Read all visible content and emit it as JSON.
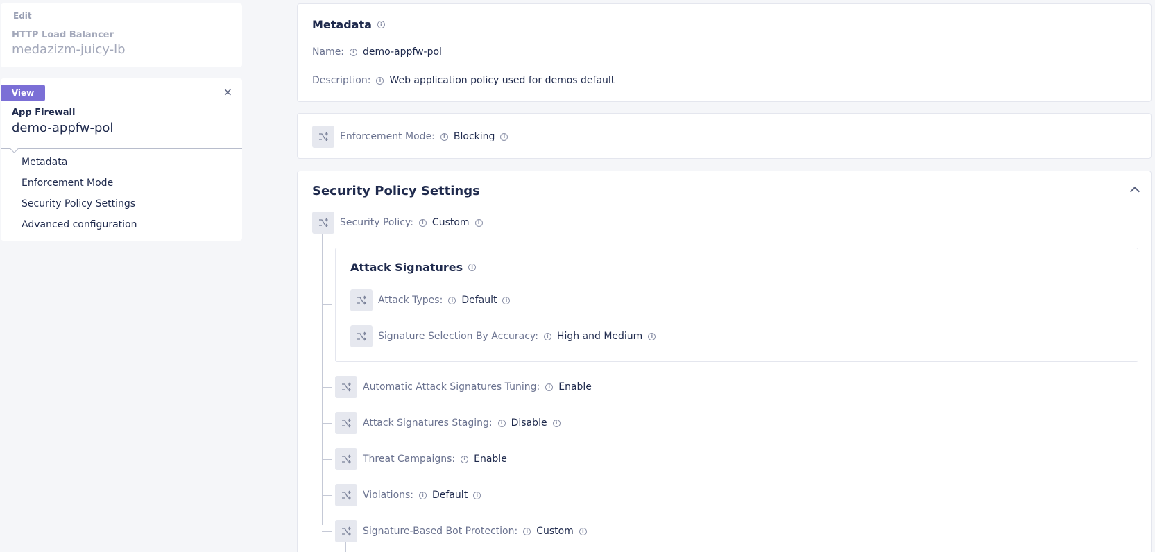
{
  "sidebar": {
    "edit": {
      "tag": "Edit",
      "type": "HTTP Load Balancer",
      "name": "medazizm-juicy-lb"
    },
    "view": {
      "badge": "View",
      "close": "×",
      "type": "App Firewall",
      "name": "demo-appfw-pol"
    },
    "nav": [
      "Metadata",
      "Enforcement Mode",
      "Security Policy Settings",
      "Advanced configuration"
    ]
  },
  "metadata": {
    "title": "Metadata",
    "name_label": "Name:",
    "name_value": "demo-appfw-pol",
    "desc_label": "Description:",
    "desc_value": "Web application policy used for demos default"
  },
  "enforcement": {
    "label": "Enforcement Mode:",
    "value": "Blocking"
  },
  "security_policy_settings": {
    "title": "Security Policy Settings",
    "policy_label": "Security Policy:",
    "policy_value": "Custom",
    "attack_signatures": {
      "title": "Attack Signatures",
      "types_label": "Attack Types:",
      "types_value": "Default",
      "accuracy_label": "Signature Selection By Accuracy:",
      "accuracy_value": "High and Medium"
    },
    "rows": [
      {
        "label": "Automatic Attack Signatures Tuning:",
        "value": "Enable"
      },
      {
        "label": "Attack Signatures Staging:",
        "value": "Disable"
      },
      {
        "label": "Threat Campaigns:",
        "value": "Enable"
      },
      {
        "label": "Violations:",
        "value": "Default"
      },
      {
        "label": "Signature-Based Bot Protection:",
        "value": "Custom"
      }
    ]
  },
  "icons": {
    "info": "info-icon",
    "branch": "branch-icon",
    "collapse": "chevron-up-icon"
  },
  "colors": {
    "accent": "#7b6fd6",
    "text": "#1f2a4d",
    "muted": "#6b7390"
  }
}
